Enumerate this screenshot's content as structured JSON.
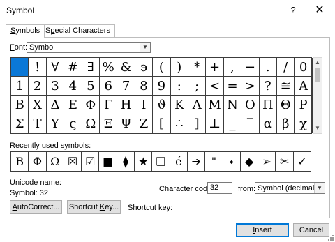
{
  "window": {
    "title": "Symbol",
    "help_glyph": "?",
    "close_glyph": "✕"
  },
  "tabs": [
    {
      "label_access": "S",
      "label_rest": "ymbols",
      "active": true
    },
    {
      "label_pre": "S",
      "label_access": "p",
      "label_rest": "ecial Characters",
      "active": false
    }
  ],
  "font": {
    "label_access": "F",
    "label_rest": "ont:",
    "value": "Symbol",
    "dropdown_icon": "chevron-down"
  },
  "grid": {
    "rows": [
      [
        " ",
        "!",
        "∀",
        "#",
        "∃",
        "%",
        "&",
        "϶",
        "(",
        ")",
        "*",
        "+",
        ",",
        "−",
        ".",
        "/",
        "0"
      ],
      [
        "1",
        "2",
        "3",
        "4",
        "5",
        "6",
        "7",
        "8",
        "9",
        ":",
        ";",
        "<",
        "=",
        ">",
        "?",
        "≅",
        "Α"
      ],
      [
        "Β",
        "Χ",
        "Δ",
        "Ε",
        "Φ",
        "Γ",
        "Η",
        "Ι",
        "ϑ",
        "Κ",
        "Λ",
        "Μ",
        "Ν",
        "Ο",
        "Π",
        "Θ",
        "Ρ"
      ],
      [
        "Σ",
        "Τ",
        "Υ",
        "ς",
        "Ω",
        "Ξ",
        "Ψ",
        "Ζ",
        "[",
        "∴",
        "]",
        "⊥",
        "_",
        "‾",
        "α",
        "β",
        "χ"
      ]
    ],
    "selected": "0-0"
  },
  "recent": {
    "label_access": "R",
    "label_rest": "ecently used symbols:",
    "symbols": [
      "Β",
      "Φ",
      "Ω",
      "☒",
      "☑",
      "■",
      "⧫",
      "★",
      "❑",
      "é",
      "➔",
      "\"",
      "⬩",
      "◆",
      "➢",
      "✂",
      "✓"
    ]
  },
  "unicode_name_label": "Unicode name:",
  "symbol_info": "Symbol: 32",
  "char_code": {
    "label_access": "C",
    "label_rest": "haracter code:",
    "value": "32"
  },
  "from": {
    "label_pre": "fro",
    "label_access": "m",
    "label_rest": ":",
    "value": "Symbol (decimal)"
  },
  "buttons": {
    "autocorrect": {
      "label_access": "A",
      "label_rest": "utoCorrect..."
    },
    "shortcut_key": {
      "label_pre": "Shortcut ",
      "label_access": "K",
      "label_rest": "ey..."
    },
    "insert": {
      "label_access": "I",
      "label_rest": "nsert"
    },
    "cancel": "Cancel"
  },
  "shortcut_key_label": "Shortcut key:"
}
